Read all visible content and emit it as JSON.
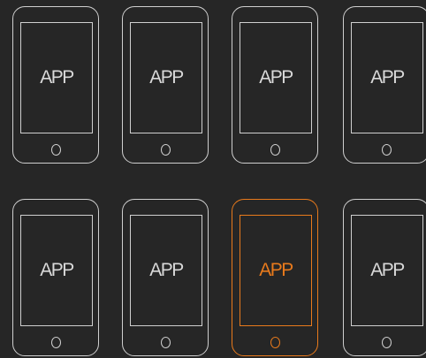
{
  "apps": [
    {
      "label": "APP",
      "selected": false
    },
    {
      "label": "APP",
      "selected": false
    },
    {
      "label": "APP",
      "selected": false
    },
    {
      "label": "APP",
      "selected": false
    },
    {
      "label": "APP",
      "selected": false
    },
    {
      "label": "APP",
      "selected": false
    },
    {
      "label": "APP",
      "selected": true
    },
    {
      "label": "APP",
      "selected": false
    }
  ],
  "colors": {
    "background": "#262626",
    "outline": "#cfcfcf",
    "selected": "#e87a1c"
  }
}
